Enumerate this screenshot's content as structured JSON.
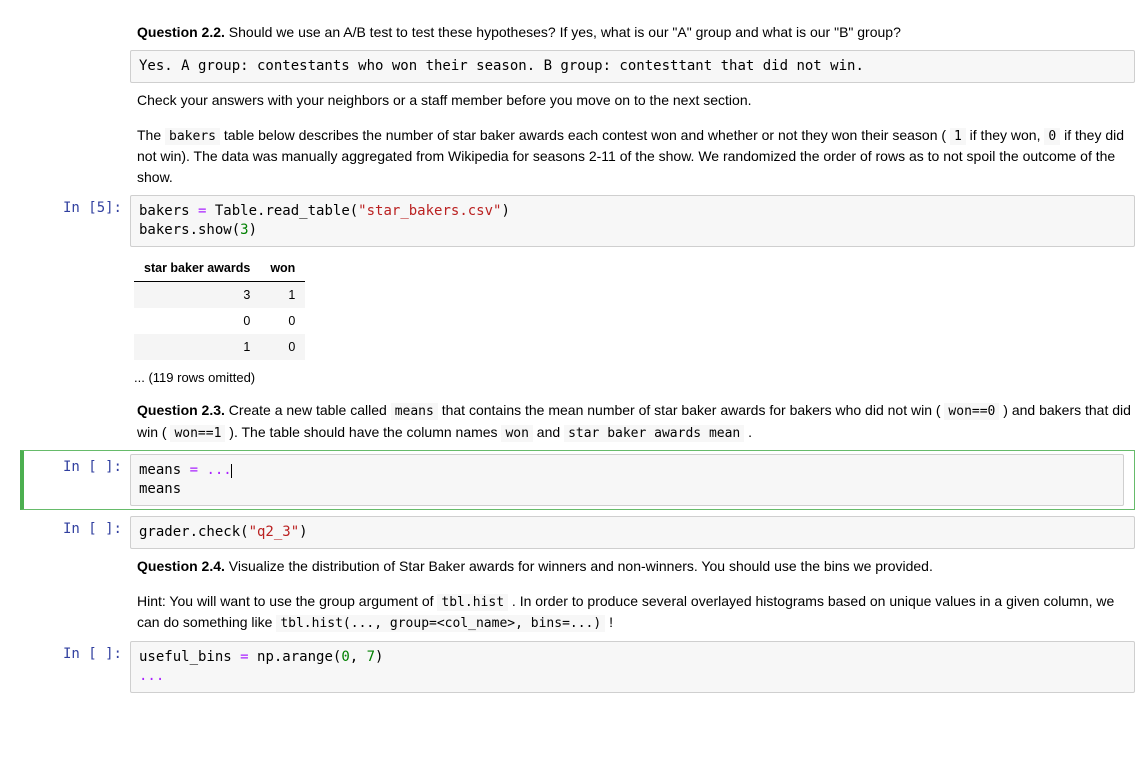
{
  "q22": {
    "label": "Question 2.2.",
    "text": " Should we use an A/B test to test these hypotheses? If yes, what is our \"A\" group and what is our \"B\" group?",
    "answer": "Yes. A group: contestants who won their season. B group: contesttant that did not win."
  },
  "check_neighbors": "Check your answers with your neighbors or a staff member before you move on to the next section.",
  "bakers_intro": {
    "p1a": "The ",
    "code1": "bakers",
    "p1b": " table below describes the number of star baker awards each contest won and whether or not they won their season ( ",
    "code2": "1",
    "p1c": " if they won, ",
    "code3": "0",
    "p1d": " if they did not win). The data was manually aggregated from Wikipedia for seasons 2-11 of the show. We randomized the order of rows as to not spoil the outcome of the show."
  },
  "cell5": {
    "prompt": "In [5]:",
    "line1_head": "bakers ",
    "line1_eq": "=",
    "line1_call": " Table.read_table(",
    "line1_str": "\"star_bakers.csv\"",
    "line1_close": ")",
    "line2_head": "bakers.show(",
    "line2_num": "3",
    "line2_close": ")"
  },
  "table": {
    "col1": "star baker awards",
    "col2": "won",
    "rows": [
      {
        "c1": "3",
        "c2": "1"
      },
      {
        "c1": "0",
        "c2": "0"
      },
      {
        "c1": "1",
        "c2": "0"
      }
    ],
    "omitted": "... (119 rows omitted)"
  },
  "q23": {
    "label": "Question 2.3.",
    "a": " Create a new table called ",
    "code1": "means",
    "b": " that contains the mean number of star baker awards for bakers who did not win ( ",
    "code2": "won==0",
    "c": " ) and bakers that did win ( ",
    "code3": "won==1",
    "d": " ). The table should have the column names ",
    "code4": "won",
    "e": " and ",
    "code5": "star baker awards mean",
    "f": " ."
  },
  "cell_means": {
    "prompt": "In [ ]:",
    "line1_a": "means ",
    "line1_eq": "=",
    "line1_b": " ",
    "line1_dots": "...",
    "line2": "means"
  },
  "cell_grader": {
    "prompt": "In [ ]:",
    "a": "grader.check(",
    "str": "\"q2_3\"",
    "b": ")"
  },
  "q24": {
    "label": "Question 2.4.",
    "text": " Visualize the distribution of Star Baker awards for winners and non-winners. You should use the bins we provided.",
    "hint_a": "Hint: You will want to use the group argument of ",
    "code1": "tbl.hist",
    "hint_b": " . In order to produce several overlayed histograms based on unique values in a given column, we can do something like ",
    "code2": "tbl.hist(..., group=<col_name>, bins=...)",
    "hint_c": " !"
  },
  "cell_bins": {
    "prompt": "In [ ]:",
    "a": "useful_bins ",
    "eq": "=",
    "b": " np.arange(",
    "n1": "0",
    "comma": ", ",
    "n2": "7",
    "c": ")",
    "dots": "..."
  }
}
